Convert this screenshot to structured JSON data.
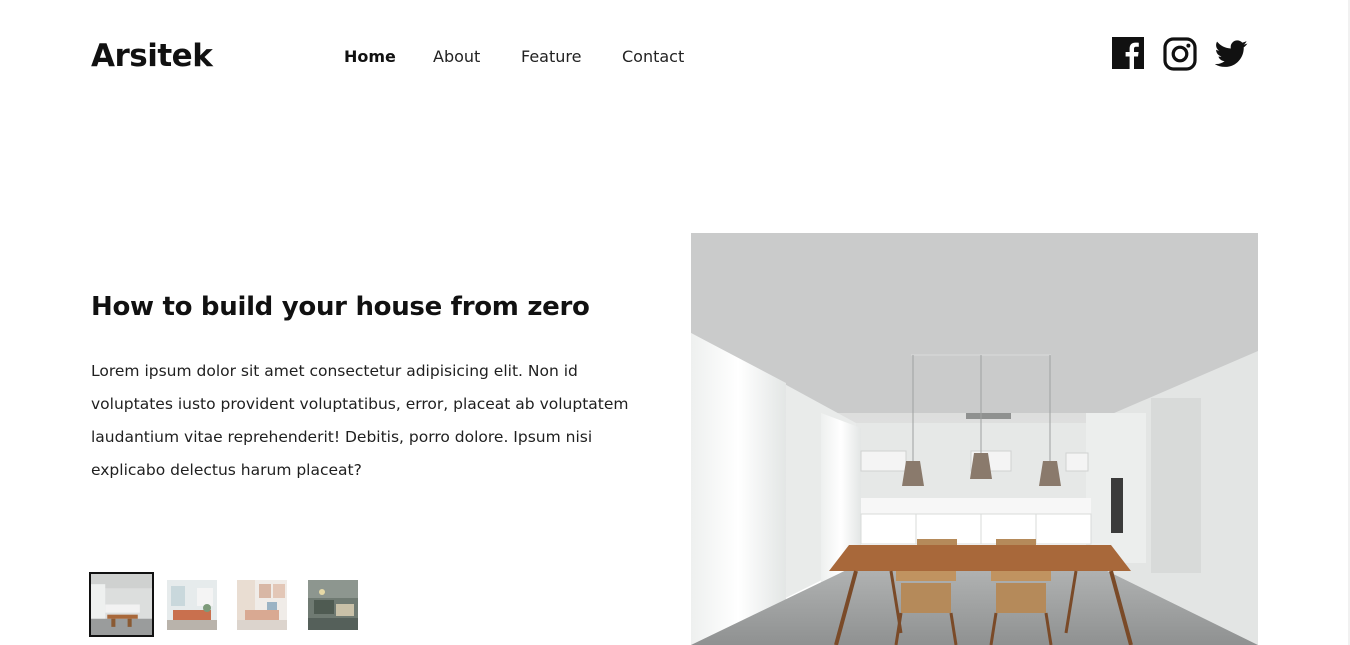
{
  "brand": {
    "name": "Arsitek"
  },
  "nav": {
    "items": [
      {
        "label": "Home",
        "active": true
      },
      {
        "label": "About",
        "active": false
      },
      {
        "label": "Feature",
        "active": false
      },
      {
        "label": "Contact",
        "active": false
      }
    ]
  },
  "social": {
    "icons": [
      "facebook-icon",
      "instagram-icon",
      "twitter-icon"
    ]
  },
  "hero": {
    "title": "How to build your house from zero",
    "text": "Lorem ipsum dolor sit amet consectetur adipisicing elit. Non id voluptates iusto provident voluptatibus, error, placeat ab voluptatem laudantium vitae reprehenderit! Debitis, porro dolore. Ipsum nisi explicabo delectus harum placeat?"
  },
  "gallery": {
    "thumbnails": 4,
    "selected_index": 0
  },
  "colors": {
    "text": "#111111",
    "background": "#ffffff",
    "wood": "#a8683a"
  }
}
